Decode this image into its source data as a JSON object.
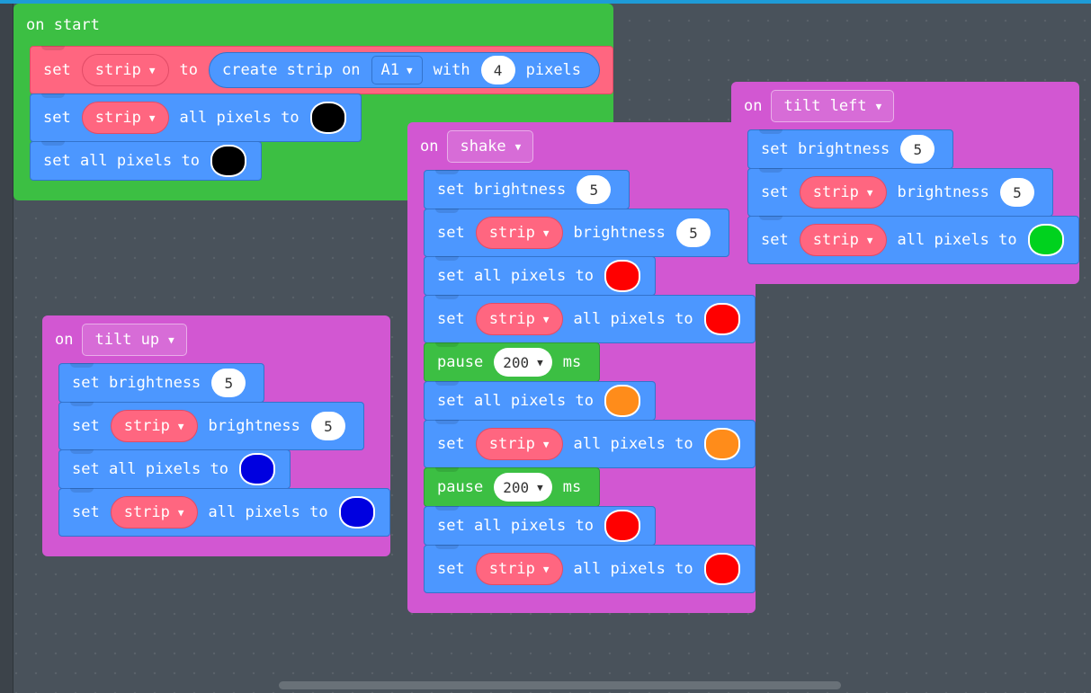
{
  "workspace": {
    "background_color": "#49525B",
    "top_bar_color": "#1E9BD7",
    "gutter_color": "#3C434A",
    "scrollbar_name": "horizontal-scrollbar"
  },
  "palette": {
    "event_green": "#3CBF43",
    "event_magenta": "#D257D2",
    "light_blue": "#4C97FF",
    "variable_pink": "#FF6680",
    "loops_green": "#3CBF43",
    "black": "#000000",
    "red": "#FF0000",
    "orange": "#FF8C1A",
    "blue": "#0000E0",
    "green": "#00D21E"
  },
  "stacks": [
    {
      "id": "on-start",
      "hat": {
        "prefix": "on start",
        "color": "#3CBF43"
      },
      "rows": [
        {
          "type": "set-var-to-reporter",
          "color": "#FF6680",
          "set_label": "set",
          "variable": "strip",
          "to_label": "to",
          "reporter": {
            "prefix": "create strip on",
            "pin": "A1",
            "with_label": "with",
            "pixels_count": "4",
            "suffix": "pixels"
          }
        },
        {
          "type": "set-strip-all-pixels",
          "color": "#4C97FF",
          "set_label": "set",
          "variable": "strip",
          "mid_label": "all pixels to",
          "swatch": "#000000"
        },
        {
          "type": "set-all-pixels",
          "color": "#4C97FF",
          "label": "set all pixels to",
          "swatch": "#000000"
        }
      ]
    },
    {
      "id": "on-shake",
      "hat": {
        "prefix": "on",
        "event": "shake",
        "color": "#D257D2"
      },
      "rows": [
        {
          "type": "set-brightness",
          "color": "#4C97FF",
          "label": "set brightness",
          "value": "5"
        },
        {
          "type": "set-strip-brightness",
          "color": "#4C97FF",
          "set_label": "set",
          "variable": "strip",
          "mid_label": "brightness",
          "value": "5"
        },
        {
          "type": "set-all-pixels",
          "color": "#4C97FF",
          "label": "set all pixels to",
          "swatch": "#FF0000"
        },
        {
          "type": "set-strip-all-pixels",
          "color": "#4C97FF",
          "set_label": "set",
          "variable": "strip",
          "mid_label": "all pixels to",
          "swatch": "#FF0000"
        },
        {
          "type": "pause",
          "color": "#3CBF43",
          "label": "pause",
          "value": "200",
          "unit": "ms"
        },
        {
          "type": "set-all-pixels",
          "color": "#4C97FF",
          "label": "set all pixels to",
          "swatch": "#FF8C1A"
        },
        {
          "type": "set-strip-all-pixels",
          "color": "#4C97FF",
          "set_label": "set",
          "variable": "strip",
          "mid_label": "all pixels to",
          "swatch": "#FF8C1A"
        },
        {
          "type": "pause",
          "color": "#3CBF43",
          "label": "pause",
          "value": "200",
          "unit": "ms"
        },
        {
          "type": "set-all-pixels",
          "color": "#4C97FF",
          "label": "set all pixels to",
          "swatch": "#FF0000"
        },
        {
          "type": "set-strip-all-pixels",
          "color": "#4C97FF",
          "set_label": "set",
          "variable": "strip",
          "mid_label": "all pixels to",
          "swatch": "#FF0000"
        }
      ]
    },
    {
      "id": "tilt-left",
      "hat": {
        "prefix": "on",
        "event": "tilt left",
        "color": "#D257D2"
      },
      "rows": [
        {
          "type": "set-brightness",
          "color": "#4C97FF",
          "label": "set brightness",
          "value": "5"
        },
        {
          "type": "set-strip-brightness",
          "color": "#4C97FF",
          "set_label": "set",
          "variable": "strip",
          "mid_label": "brightness",
          "value": "5"
        },
        {
          "type": "set-strip-all-pixels",
          "color": "#4C97FF",
          "set_label": "set",
          "variable": "strip",
          "mid_label": "all pixels to",
          "swatch": "#00D21E"
        }
      ]
    },
    {
      "id": "tilt-up",
      "hat": {
        "prefix": "on",
        "event": "tilt up",
        "color": "#D257D2"
      },
      "rows": [
        {
          "type": "set-brightness",
          "color": "#4C97FF",
          "label": "set brightness",
          "value": "5"
        },
        {
          "type": "set-strip-brightness",
          "color": "#4C97FF",
          "set_label": "set",
          "variable": "strip",
          "mid_label": "brightness",
          "value": "5"
        },
        {
          "type": "set-all-pixels",
          "color": "#4C97FF",
          "label": "set all pixels to",
          "swatch": "#0000E0"
        },
        {
          "type": "set-strip-all-pixels",
          "color": "#4C97FF",
          "set_label": "set",
          "variable": "strip",
          "mid_label": "all pixels to",
          "swatch": "#0000E0"
        }
      ]
    }
  ],
  "icons": {
    "caret_down": "▼"
  }
}
